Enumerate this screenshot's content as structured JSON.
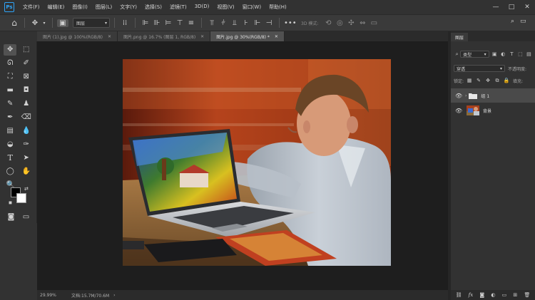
{
  "app": {
    "logo": "Ps",
    "menu": [
      "文件(F)",
      "编辑(E)",
      "图像(I)",
      "图层(L)",
      "文字(Y)",
      "选择(S)",
      "滤镜(T)",
      "3D(D)",
      "视图(V)",
      "窗口(W)",
      "帮助(H)"
    ],
    "window_controls": [
      "—",
      "□",
      "✕"
    ]
  },
  "options_bar": {
    "layer_select": "图层",
    "mode_3d": "3D 模式:"
  },
  "tabs": [
    {
      "label": "图片 (1).jpg @ 100%(RGB/8)",
      "active": false
    },
    {
      "label": "图片.png @ 16.7% (图层 1, RGB/8)",
      "active": false
    },
    {
      "label": "图片.jpg @ 30%(RGB/8) *",
      "active": true
    }
  ],
  "status": {
    "zoom": "29.99%",
    "doc_size": "文档:15.7M/70.6M",
    "arrow": "›"
  },
  "panel": {
    "title": "图层",
    "filter_type": "类型",
    "blend_mode": "穿透",
    "opacity_label": "不透明度:",
    "lock_label": "锁定:",
    "fill_label": "填充:",
    "layers": [
      {
        "name": "组 1",
        "kind": "group",
        "selected": true
      },
      {
        "name": "背景",
        "kind": "image",
        "selected": false
      }
    ]
  },
  "colors": {
    "foreground": "#000000",
    "background": "#ffffff",
    "accent": "#2fa3f6"
  }
}
